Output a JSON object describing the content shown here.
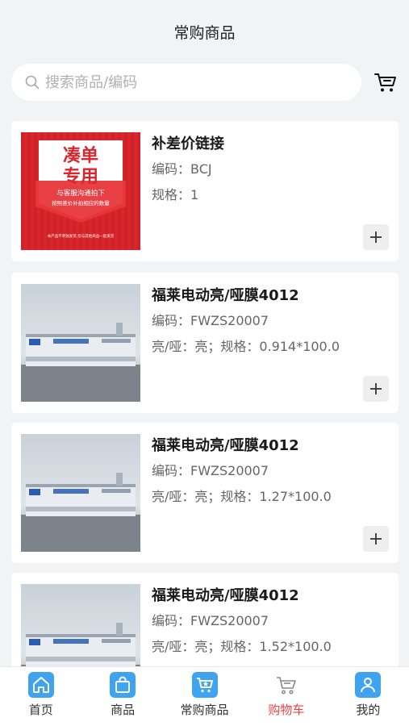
{
  "header": {
    "title": "常购商品"
  },
  "search": {
    "placeholder": "搜索商品/编码"
  },
  "products": [
    {
      "name": "补差价链接",
      "code": "编码：BCJ",
      "spec": "规格：1",
      "image": "promo-banner",
      "image_text": {
        "line1": "凑单",
        "line2": "专用",
        "line3": "与客服沟通拍下",
        "line4": "按照差价补拍相应的数量",
        "footer": "本产品不单独发货,仅与其他商品一起发货"
      }
    },
    {
      "name": "福莱电动亮/哑膜4012",
      "code": "编码：FWZS20007",
      "spec": "亮/哑：亮；规格：0.914*100.0",
      "image": "product-photo"
    },
    {
      "name": "福莱电动亮/哑膜4012",
      "code": "编码：FWZS20007",
      "spec": "亮/哑：亮；规格：1.27*100.0",
      "image": "product-photo"
    },
    {
      "name": "福莱电动亮/哑膜4012",
      "code": "编码：FWZS20007",
      "spec": "亮/哑：亮；规格：1.52*100.0",
      "image": "product-photo"
    }
  ],
  "tabbar": [
    {
      "label": "首页",
      "icon": "home-icon"
    },
    {
      "label": "商品",
      "icon": "bag-icon"
    },
    {
      "label": "常购商品",
      "icon": "frequent-cart-icon"
    },
    {
      "label": "购物车",
      "icon": "cart-icon",
      "active": true
    },
    {
      "label": "我的",
      "icon": "user-icon"
    }
  ],
  "colors": {
    "accent": "#e64340",
    "tab_icon_bg": "#3fa3f0",
    "promo_red": "#d9262c"
  }
}
